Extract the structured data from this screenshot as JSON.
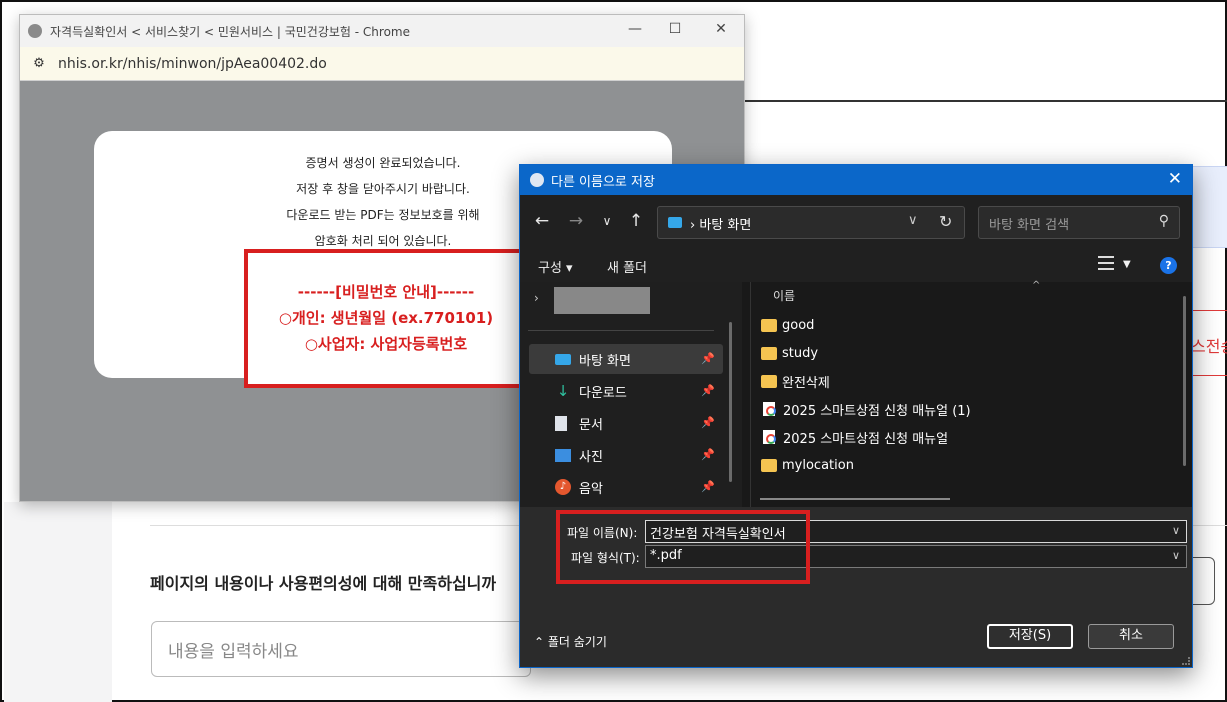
{
  "background_page": {
    "right_red_button_text": "스전송",
    "satisfaction_question": "페이지의 내용이나 사용편의성에 대해 만족하십니까",
    "input_placeholder": "내용을 입력하세요"
  },
  "chrome_popup": {
    "window_title": "자격득실확인서 < 서비스찾기 < 민원서비스 | 국민건강보험 - Chrome",
    "url": "nhis.or.kr/nhis/minwon/jpAea00402.do",
    "message_lines": [
      "증명서 생성이 완료되었습니다.",
      "저장 후 창을 닫아주시기 바랍니다.",
      "다운로드 받는 PDF는 정보보호를 위해",
      "암호화 처리 되어 있습니다."
    ],
    "password_notice": {
      "heading": "------[비밀번호 안내]------",
      "personal": "○개인: 생년월일 (ex.770101)",
      "business": "○사업자: 사업자등록번호"
    }
  },
  "save_dialog": {
    "title": "다른 이름으로 저장",
    "address_crumb": "바탕 화면",
    "search_placeholder": "바탕 화면 검색",
    "organize_label": "구성 ▾",
    "new_folder_label": "새 폴더",
    "column_header": "이름",
    "nav_items": [
      {
        "label": "바탕 화면",
        "icon": "desktop-icon",
        "selected": true
      },
      {
        "label": "다운로드",
        "icon": "download-icon",
        "selected": false
      },
      {
        "label": "문서",
        "icon": "document-icon",
        "selected": false
      },
      {
        "label": "사진",
        "icon": "picture-icon",
        "selected": false
      },
      {
        "label": "음악",
        "icon": "music-icon",
        "selected": false
      }
    ],
    "files": [
      {
        "name": "good",
        "type": "folder"
      },
      {
        "name": "study",
        "type": "folder"
      },
      {
        "name": "완전삭제",
        "type": "folder"
      },
      {
        "name": "2025 스마트상점 신청 매뉴얼 (1)",
        "type": "doc"
      },
      {
        "name": "2025 스마트상점 신청 매뉴얼",
        "type": "doc"
      },
      {
        "name": "mylocation",
        "type": "folder"
      }
    ],
    "filename_label": "파일 이름(N):",
    "filename_value": "건강보험 자격득실확인서",
    "filetype_label": "파일 형식(T):",
    "filetype_value": "*.pdf",
    "hide_folders_label": "폴더 숨기기",
    "save_button": "저장(S)",
    "cancel_button": "취소"
  }
}
